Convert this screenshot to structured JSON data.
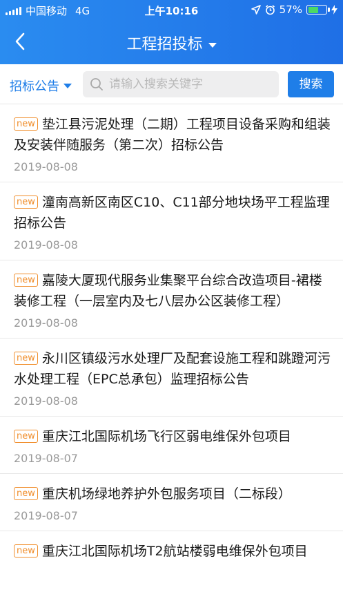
{
  "status_bar": {
    "carrier": "中国移动",
    "network": "4G",
    "time": "上午10:16",
    "battery": "57%",
    "battery_level": 0.57
  },
  "nav": {
    "title": "工程招投标",
    "back_icon": "chevron-left-icon"
  },
  "search": {
    "filter_label": "招标公告",
    "placeholder": "请输入搜索关键字",
    "button_label": "搜索"
  },
  "items": [
    {
      "badge": "new",
      "title": "垫江县污泥处理（二期）工程项目设备采购和组装及安装伴随服务（第二次）招标公告",
      "date": "2019-08-08"
    },
    {
      "badge": "new",
      "title": "潼南高新区南区C10、C11部分地块场平工程监理招标公告",
      "date": "2019-08-08"
    },
    {
      "badge": "new",
      "title": "嘉陵大厦现代服务业集聚平台综合改造项目-裙楼装修工程（一层室内及七八层办公区装修工程）",
      "date": "2019-08-08"
    },
    {
      "badge": "new",
      "title": "永川区镇级污水处理厂及配套设施工程和跳蹬河污水处理工程（EPC总承包）监理招标公告",
      "date": "2019-08-08"
    },
    {
      "badge": "new",
      "title": "重庆江北国际机场飞行区弱电维保外包项目",
      "date": "2019-08-07"
    },
    {
      "badge": "new",
      "title": "重庆机场绿地养护外包服务项目（二标段）",
      "date": "2019-08-07"
    },
    {
      "badge": "new",
      "title": "重庆江北国际机场T2航站楼弱电维保外包项目",
      "date": ""
    }
  ]
}
